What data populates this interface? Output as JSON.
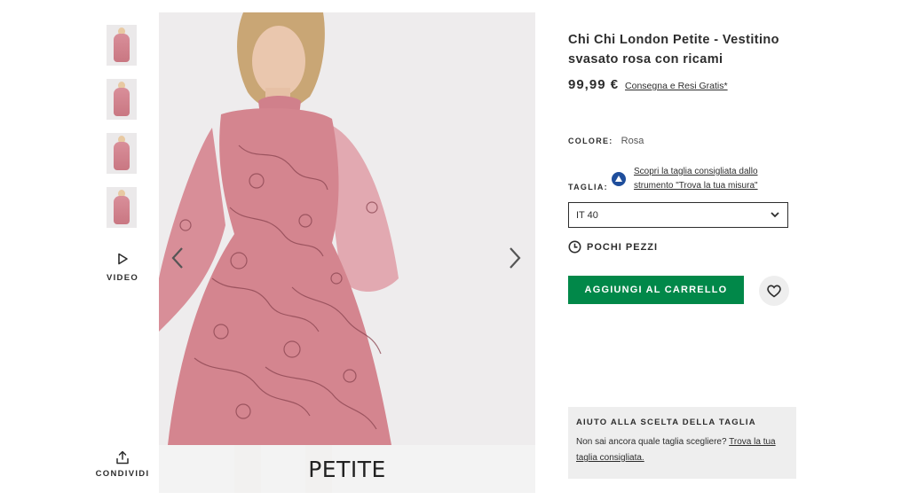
{
  "gallery": {
    "thumbnails": [
      "thumbnail-1",
      "thumbnail-2",
      "thumbnail-3",
      "thumbnail-4"
    ],
    "video_label": "VIDEO",
    "share_label": "CONDIVIDI",
    "image_banner": "PETITE"
  },
  "product": {
    "title": "Chi Chi London Petite - Vestitino svasato rosa con ricami",
    "price": "99,99 €",
    "delivery_link": "Consegna e Resi Gratis*",
    "colour_label": "COLORE:",
    "colour_value": "Rosa",
    "size_label": "TAGLIA:",
    "fit_assistant_text": "Scopri la taglia consigliata dallo strumento \"Trova la tua misura\"",
    "selected_size": "IT 40",
    "stock_status": "POCHI PEZZI",
    "add_to_bag": "AGGIUNGI AL CARRELLO"
  },
  "size_help": {
    "title": "AIUTO ALLA SCELTA DELLA TAGLIA",
    "text": "Non sai ancora quale taglia scegliere?",
    "link": "Trova la tua taglia consigliata."
  },
  "colors": {
    "accent_green": "#018849",
    "dress_pink": "#d4858f",
    "text": "#2d2d2d"
  },
  "icons": [
    "play-icon",
    "share-icon",
    "chevron-left-icon",
    "chevron-right-icon",
    "chevron-down-icon",
    "clock-icon",
    "heart-icon",
    "fit-assistant-icon"
  ]
}
